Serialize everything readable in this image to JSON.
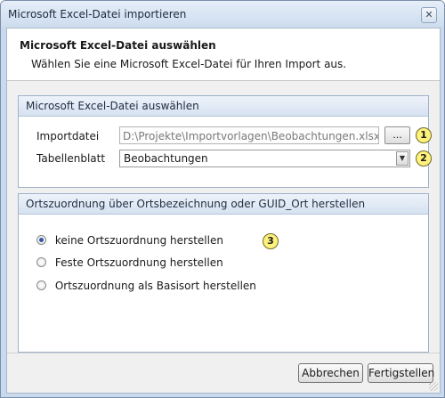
{
  "window": {
    "title": "Microsoft Excel-Datei importieren",
    "close_label": "✕"
  },
  "header": {
    "title": "Microsoft Excel-Datei auswählen",
    "subtitle": "Wählen Sie eine Microsoft Excel-Datei für Ihren Import aus."
  },
  "file_group": {
    "title": "Microsoft Excel-Datei auswählen",
    "import_label": "Importdatei",
    "import_value": "D:\\Projekte\\Importvorlagen\\Beobachtungen.xlsx",
    "browse_label": "...",
    "sheet_label": "Tabellenblatt",
    "sheet_value": "Beobachtungen",
    "sheet_arrow": "▼"
  },
  "location_group": {
    "title": "Ortszuordnung über Ortsbezeichnung oder GUID_Ort herstellen",
    "options": [
      {
        "label": "keine Ortszuordnung herstellen",
        "selected": true
      },
      {
        "label": "Feste Ortszuordnung herstellen",
        "selected": false
      },
      {
        "label": "Ortszuordnung als Basisort herstellen",
        "selected": false
      }
    ]
  },
  "badges": [
    "1",
    "2",
    "3"
  ],
  "footer": {
    "cancel_label": "Abbrechen",
    "finish_label": "Fertigstellen"
  },
  "colors": {
    "badge": "#fff27a",
    "title_bar": "#cddcee",
    "group_header": "#d6e2f1"
  }
}
